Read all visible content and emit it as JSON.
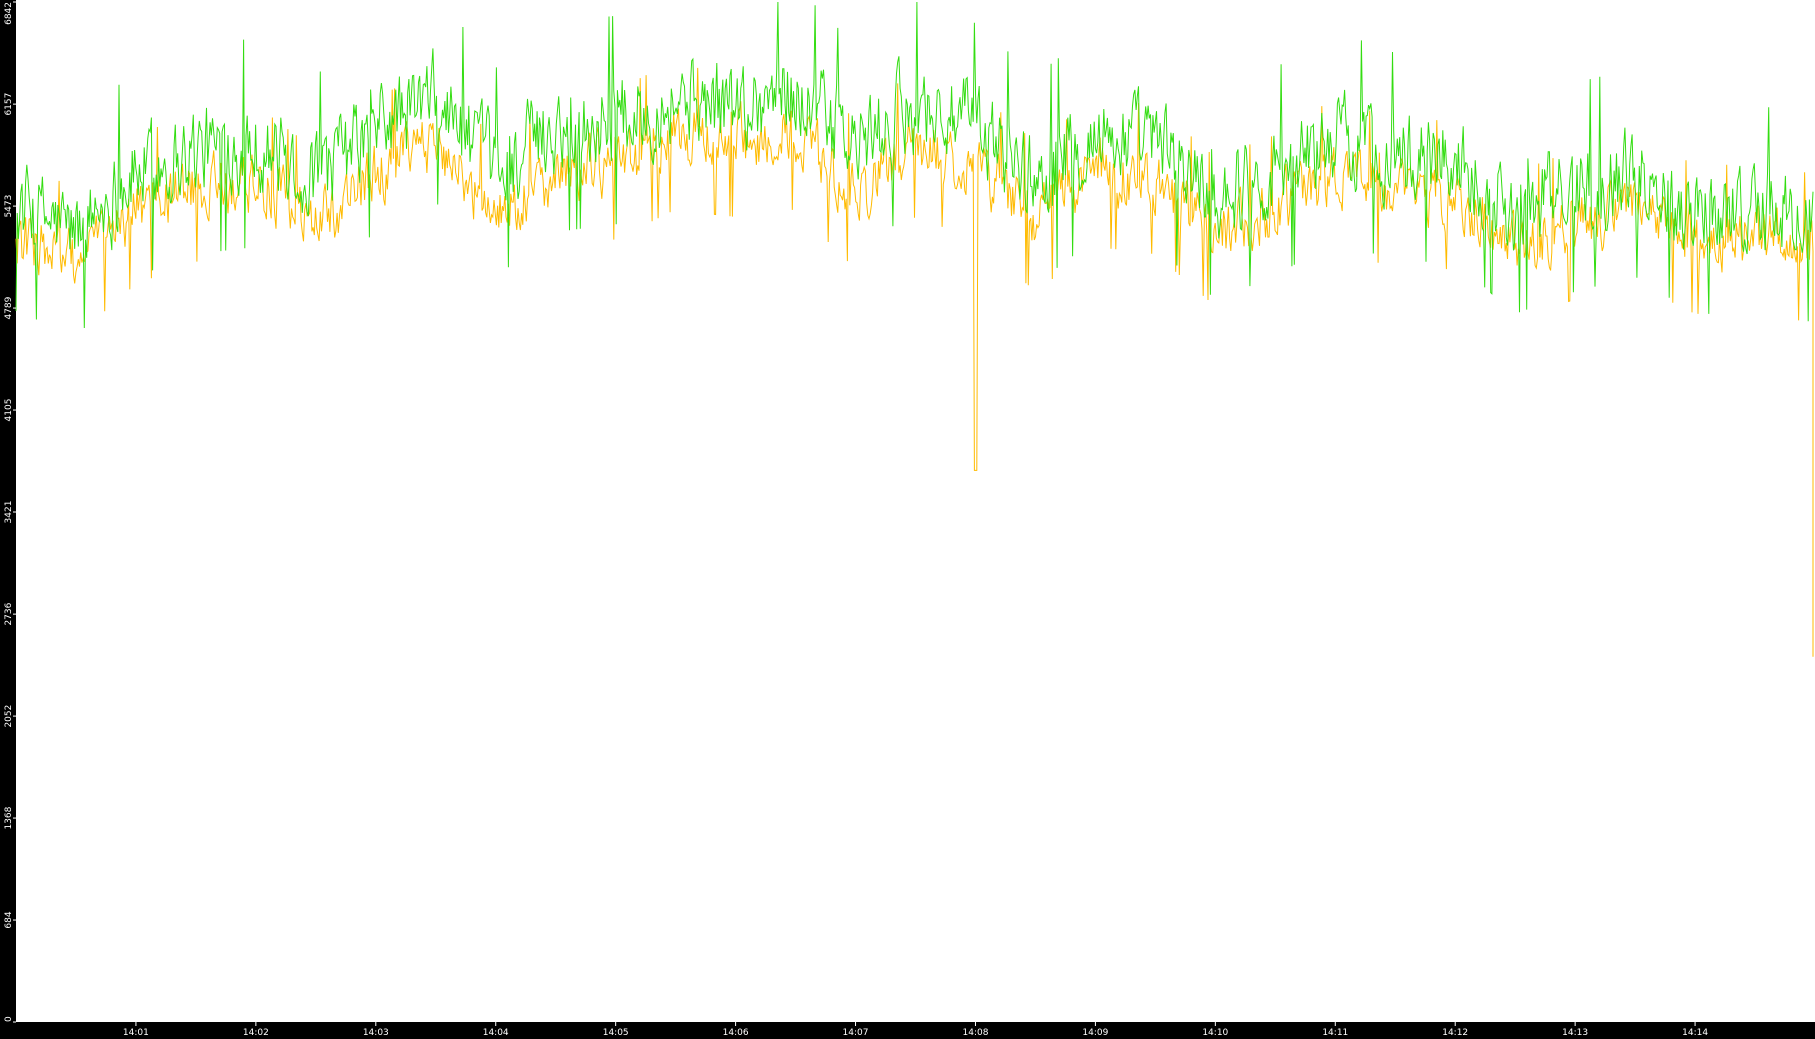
{
  "chart_data": {
    "type": "line",
    "title": "",
    "xlabel": "",
    "ylabel": "",
    "ylim": [
      0,
      6842
    ],
    "xlim": [
      "14:00:00",
      "14:15:00"
    ],
    "y_ticks": [
      0,
      684,
      1368,
      2052,
      2736,
      3421,
      4105,
      4789,
      5473,
      6157,
      6842
    ],
    "x_ticks": [
      "14:01",
      "14:02",
      "14:03",
      "14:04",
      "14:05",
      "14:06",
      "14:07",
      "14:08",
      "14:09",
      "14:10",
      "14:11",
      "14:12",
      "14:13",
      "14:14"
    ],
    "grid": false,
    "legend": "none",
    "series": [
      {
        "color": "#33dd11",
        "times": [
          "14:00:00",
          "14:00:30",
          "14:01:00",
          "14:01:30",
          "14:02:00",
          "14:02:30",
          "14:03:00",
          "14:03:30",
          "14:04:00",
          "14:04:30",
          "14:05:00",
          "14:05:30",
          "14:06:00",
          "14:06:30",
          "14:07:00",
          "14:07:30",
          "14:08:00",
          "14:08:30",
          "14:09:00",
          "14:09:30",
          "14:10:00",
          "14:10:30",
          "14:11:00",
          "14:11:30",
          "14:12:00",
          "14:12:30",
          "14:13:00",
          "14:13:30",
          "14:14:00",
          "14:14:30",
          "14:14:55"
        ],
        "values": [
          5470,
          5300,
          5700,
          5850,
          5900,
          5650,
          6000,
          6200,
          5700,
          6000,
          6050,
          6200,
          6150,
          6250,
          5850,
          6150,
          6000,
          5650,
          5950,
          5900,
          5550,
          5700,
          5950,
          5800,
          5800,
          5450,
          5600,
          5700,
          5450,
          5450,
          5400
        ],
        "noise_min": 4650,
        "noise_max": 6842
      },
      {
        "color": "#ffbb00",
        "times": [
          "14:00:00",
          "14:00:30",
          "14:01:00",
          "14:01:30",
          "14:02:00",
          "14:02:30",
          "14:03:00",
          "14:03:30",
          "14:04:00",
          "14:04:30",
          "14:05:00",
          "14:05:30",
          "14:06:00",
          "14:06:30",
          "14:07:00",
          "14:07:30",
          "14:08:00",
          "14:08:30",
          "14:09:00",
          "14:09:30",
          "14:10:00",
          "14:10:30",
          "14:11:00",
          "14:11:30",
          "14:12:00",
          "14:12:30",
          "14:13:00",
          "14:13:30",
          "14:14:00",
          "14:14:30",
          "14:14:55"
        ],
        "values": [
          5250,
          5100,
          5450,
          5600,
          5650,
          5350,
          5700,
          5900,
          5400,
          5700,
          5750,
          5950,
          5900,
          5950,
          5550,
          5900,
          5750,
          5400,
          5700,
          5650,
          5300,
          5450,
          5700,
          5550,
          5550,
          5200,
          5350,
          5450,
          5250,
          5250,
          5200
        ],
        "noise_min": 4700,
        "noise_max": 6400,
        "dip": {
          "time": "14:08:00",
          "value": 3700
        },
        "end_drop": {
          "time": "14:14:59",
          "value": 2450
        }
      }
    ]
  }
}
